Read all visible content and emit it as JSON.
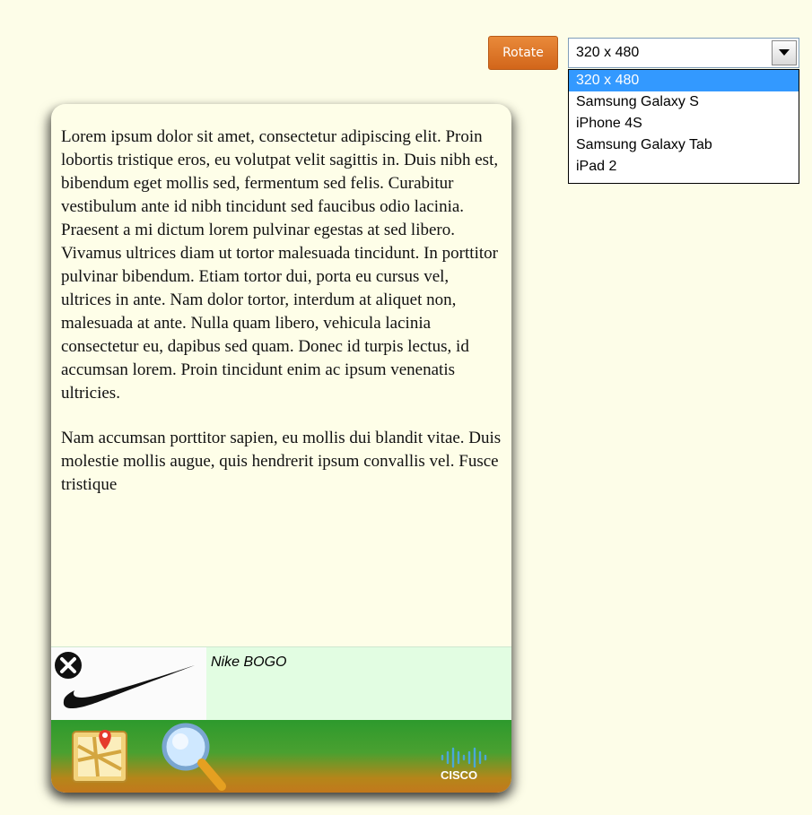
{
  "controls": {
    "rotate_label": "Rotate",
    "device_select": {
      "selected": "320 x 480",
      "options": [
        "320 x 480",
        "Samsung Galaxy S",
        "iPhone 4S",
        "Samsung Galaxy Tab",
        "iPad 2"
      ]
    }
  },
  "article": {
    "paragraphs": [
      "Lorem ipsum dolor sit amet, consectetur adipiscing elit. Proin lobortis tristique eros, eu volutpat velit sagittis in. Duis nibh est, bibendum eget mollis sed, fermentum sed felis. Curabitur vestibulum ante id nibh tincidunt sed faucibus odio lacinia. Praesent a mi dictum lorem pulvinar egestas at sed libero. Vivamus ultrices diam ut tortor malesuada tincidunt. In porttitor pulvinar bibendum. Etiam tortor dui, porta eu cursus vel, ultrices in ante. Nam dolor tortor, interdum at aliquet non, malesuada at ante. Nulla quam libero, vehicula lacinia consectetur eu, dapibus sed quam. Donec id turpis lectus, id accumsan lorem. Proin tincidunt enim ac ipsum venenatis ultricies.",
      "Nam accumsan porttitor sapien, eu mollis dui blandit vitae. Duis molestie mollis augue, quis hendrerit ipsum convallis vel. Fusce tristique"
    ]
  },
  "ad": {
    "text": "Nike BOGO",
    "icons": [
      "close-icon",
      "nike-swoosh-image"
    ]
  },
  "toolbar": {
    "icons": [
      "map-icon",
      "search-icon",
      "cisco-logo"
    ],
    "logo_text": "CISCO"
  },
  "colors": {
    "page_bg": "#fdfde8",
    "rotate_button": "#de7420",
    "selected_option": "#3399ff",
    "ad_bg": "#e2fde2",
    "toolbar_top": "#2d9a2d",
    "toolbar_bottom": "#c2781c"
  }
}
